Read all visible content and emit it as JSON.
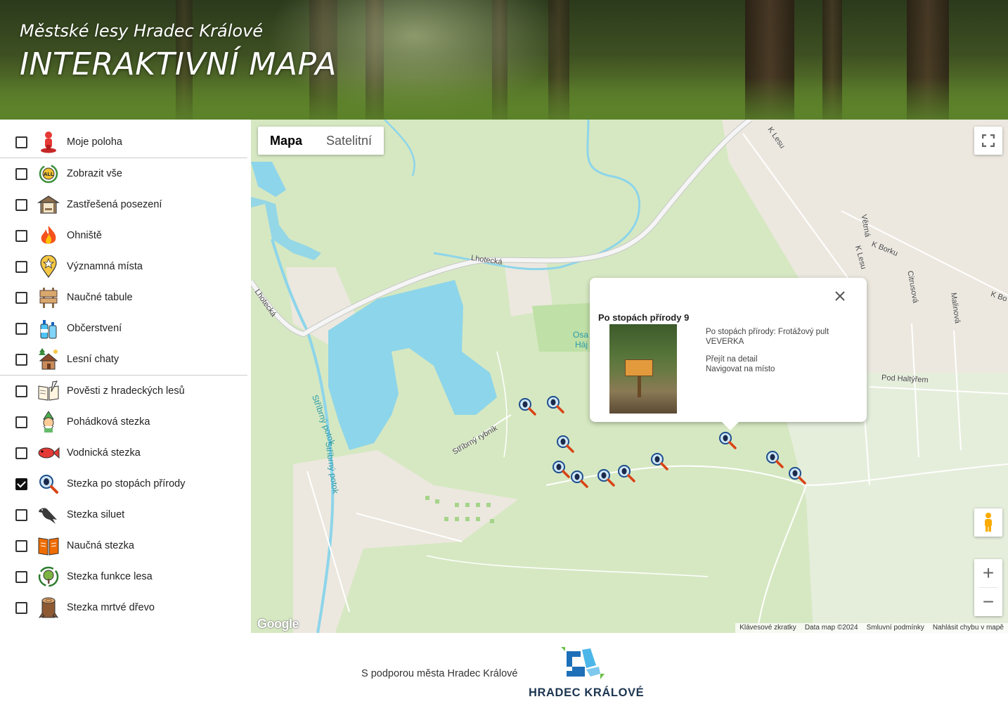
{
  "header": {
    "subtitle": "Městské lesy Hradec Králové",
    "title": "INTERAKTIVNÍ MAPA"
  },
  "sidebar": {
    "groups": [
      [
        {
          "label": "Moje poloha",
          "icon": "person-location-icon",
          "checked": false
        }
      ],
      [
        {
          "label": "Zobrazit vše",
          "icon": "all-icon",
          "checked": false
        },
        {
          "label": "Zastřešená posezení",
          "icon": "shelter-icon",
          "checked": false
        },
        {
          "label": "Ohniště",
          "icon": "fire-icon",
          "checked": false
        },
        {
          "label": "Významná místa",
          "icon": "star-pin-icon",
          "checked": false
        },
        {
          "label": "Naučné tabule",
          "icon": "signboard-icon",
          "checked": false
        },
        {
          "label": "Občerstvení",
          "icon": "bottles-icon",
          "checked": false
        },
        {
          "label": "Lesní chaty",
          "icon": "cabin-icon",
          "checked": false
        }
      ],
      [
        {
          "label": "Pověsti z hradeckých lesů",
          "icon": "book-quill-icon",
          "checked": false
        },
        {
          "label": "Pohádková stezka",
          "icon": "elf-icon",
          "checked": false
        },
        {
          "label": "Vodnická stezka",
          "icon": "fish-icon",
          "checked": false
        },
        {
          "label": "Stezka po stopách přírody",
          "icon": "magnifier-beetle-icon",
          "checked": true
        },
        {
          "label": "Stezka siluet",
          "icon": "bird-silhouette-icon",
          "checked": false
        },
        {
          "label": "Naučná stezka",
          "icon": "open-book-icon",
          "checked": false
        },
        {
          "label": "Stezka funkce lesa",
          "icon": "tree-cycle-icon",
          "checked": false
        },
        {
          "label": "Stezka mrtvé dřevo",
          "icon": "log-icon",
          "checked": false
        }
      ]
    ]
  },
  "map": {
    "map_type_buttons": [
      "Mapa",
      "Satelitní"
    ],
    "active_map_type": "Mapa",
    "road_labels": [
      "Lhotecká",
      "Lhotecká",
      "K Lesu",
      "K Lesu",
      "Větrná",
      "K Borku",
      "Citrusová",
      "Malinová",
      "Pod Haltýřem",
      "K Bo",
      "Stříbrný rybník"
    ],
    "water_labels": [
      "Stříbrný potok",
      "Stříbrný potok"
    ],
    "park_label_lines": [
      "Osa",
      "Háj"
    ],
    "google_logo": "Google",
    "attribution": [
      "Klávesové zkratky",
      "Data map ©2024",
      "Smluvní podmínky",
      "Nahlásit chybu v mapě"
    ],
    "zoom_in": "+",
    "zoom_out": "−",
    "marker_icon": "magnifier-beetle-icon",
    "colors": {
      "land": "#d6e8c2",
      "water": "#8dd5ea",
      "urban": "#ece8df",
      "road": "#ffffff"
    }
  },
  "popup": {
    "title": "Po stopách přírody 9",
    "description": "Po stopách přírody: Frotážový pult VEVERKA",
    "link_detail": "Přejít na detail",
    "link_navigate": "Navigovat na místo",
    "close_icon": "close-icon"
  },
  "footer": {
    "support_text": "S podporou města Hradec Králové",
    "logo_text": "HRADEC  KRÁLOVÉ"
  }
}
